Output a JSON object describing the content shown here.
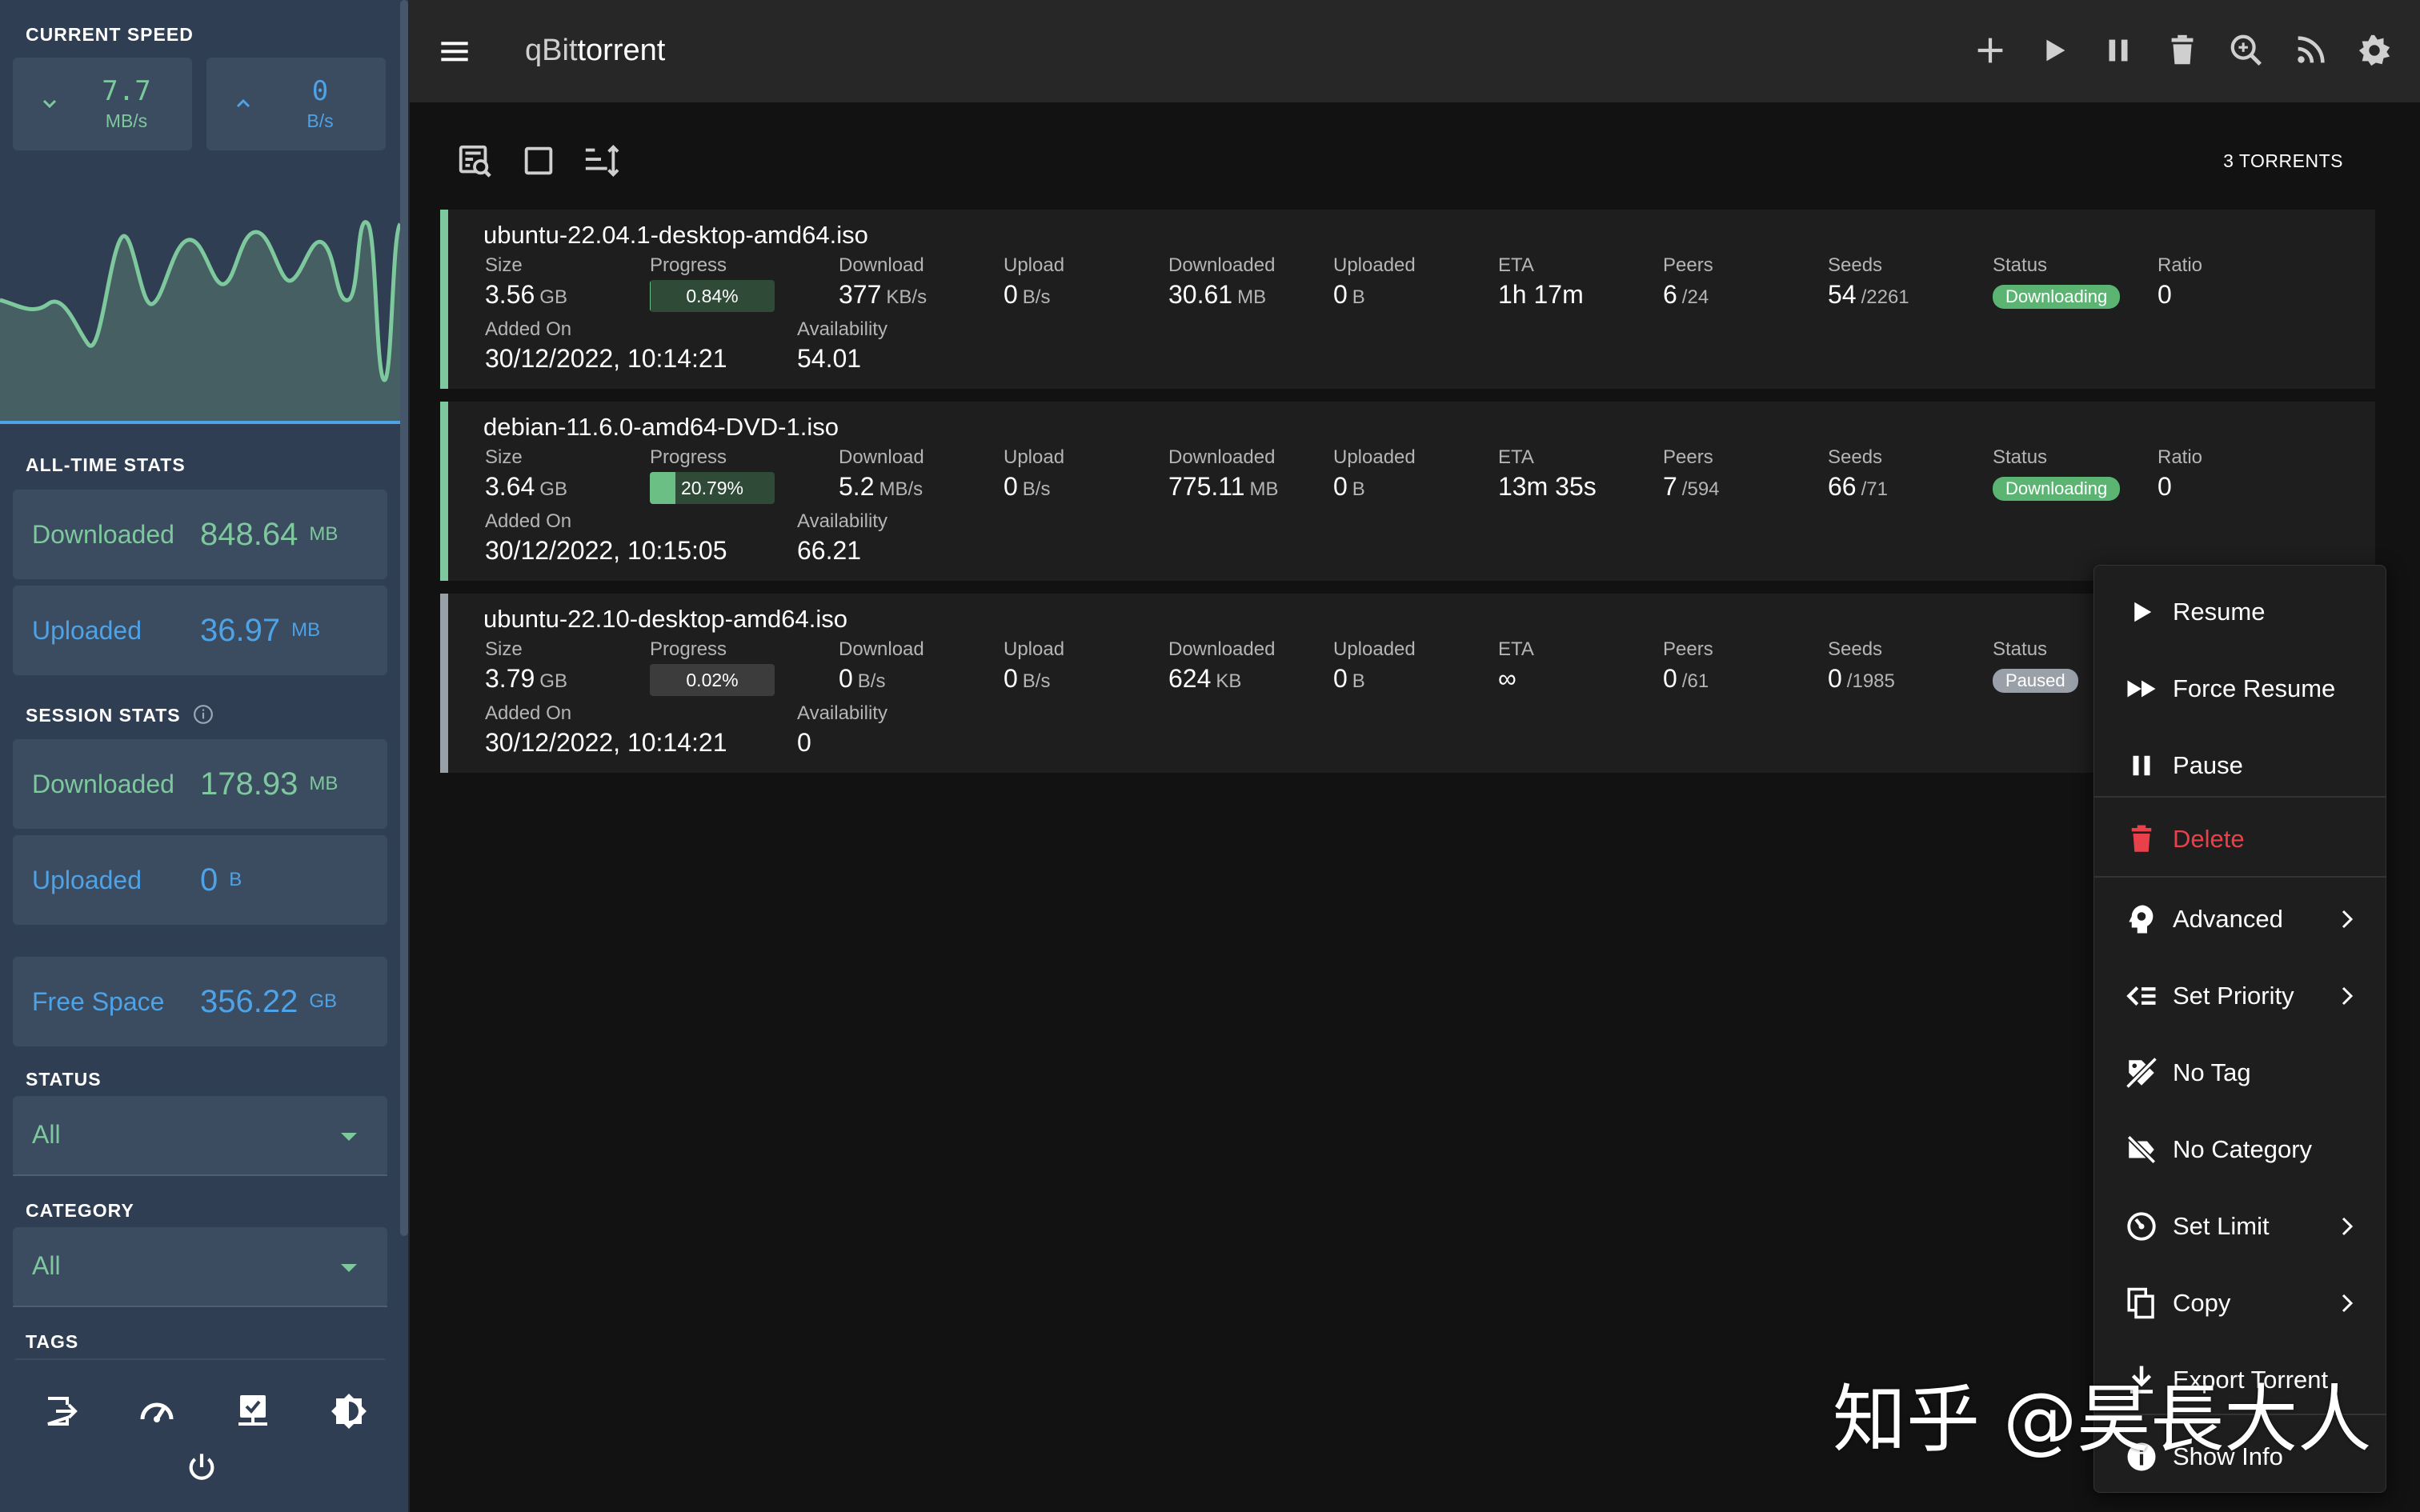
{
  "sidebar": {
    "current_speed_title": "CURRENT SPEED",
    "download_speed": {
      "value": "7.7",
      "unit": "MB/s"
    },
    "upload_speed": {
      "value": "0",
      "unit": "B/s"
    },
    "alltime_title": "ALL-TIME STATS",
    "alltime": {
      "downloaded": {
        "label": "Downloaded",
        "value": "848.64",
        "unit": "MB"
      },
      "uploaded": {
        "label": "Uploaded",
        "value": "36.97",
        "unit": "MB"
      }
    },
    "session_title": "SESSION STATS",
    "session": {
      "downloaded": {
        "label": "Downloaded",
        "value": "178.93",
        "unit": "MB"
      },
      "uploaded": {
        "label": "Uploaded",
        "value": "0",
        "unit": "B"
      }
    },
    "free_space": {
      "label": "Free Space",
      "value": "356.22",
      "unit": "GB"
    },
    "status_title": "STATUS",
    "status_value": "All",
    "category_title": "CATEGORY",
    "category_value": "All",
    "tags_title": "TAGS",
    "footer_icons": [
      "logout-icon",
      "speedometer-icon",
      "server-network-icon",
      "theme-brightness-icon",
      "power-icon"
    ]
  },
  "topbar": {
    "title_prefix": "qBit",
    "title_suffix": "torrent",
    "actions": [
      "add-icon",
      "play-icon",
      "pause-icon",
      "delete-icon",
      "search-plugin-icon",
      "rss-icon",
      "settings-icon"
    ]
  },
  "toolbar": {
    "icons": [
      "filter-search-icon",
      "checkbox-blank-icon",
      "sort-icon"
    ],
    "torrent_count": "3 TORRENTS"
  },
  "columns": {
    "size": "Size",
    "progress": "Progress",
    "download": "Download",
    "upload": "Upload",
    "downloaded": "Downloaded",
    "uploaded": "Uploaded",
    "eta": "ETA",
    "peers": "Peers",
    "seeds": "Seeds",
    "status": "Status",
    "ratio": "Ratio",
    "added_on": "Added On",
    "availability": "Availability"
  },
  "torrents": [
    {
      "name": "ubuntu-22.04.1-desktop-amd64.iso",
      "size": "3.56",
      "size_unit": "GB",
      "progress_text": "0.84%",
      "progress_value": 0.0084,
      "download": "377",
      "download_unit": "KB/s",
      "upload": "0",
      "upload_unit": "B/s",
      "downloaded": "30.61",
      "downloaded_unit": "MB",
      "uploaded": "0",
      "uploaded_unit": "B",
      "eta": "1h 17m",
      "peers": "6",
      "peers_total": "/24",
      "seeds": "54",
      "seeds_total": "/2261",
      "status": "Downloading",
      "ratio": "0",
      "added_on": "30/12/2022, 10:14:21",
      "availability": "54.01"
    },
    {
      "name": "debian-11.6.0-amd64-DVD-1.iso",
      "size": "3.64",
      "size_unit": "GB",
      "progress_text": "20.79%",
      "progress_value": 0.2079,
      "download": "5.2",
      "download_unit": "MB/s",
      "upload": "0",
      "upload_unit": "B/s",
      "downloaded": "775.11",
      "downloaded_unit": "MB",
      "uploaded": "0",
      "uploaded_unit": "B",
      "eta": "13m 35s",
      "peers": "7",
      "peers_total": "/594",
      "seeds": "66",
      "seeds_total": "/71",
      "status": "Downloading",
      "ratio": "0",
      "added_on": "30/12/2022, 10:15:05",
      "availability": "66.21"
    },
    {
      "name": "ubuntu-22.10-desktop-amd64.iso",
      "size": "3.79",
      "size_unit": "GB",
      "progress_text": "0.02%",
      "progress_value": 0.0002,
      "download": "0",
      "download_unit": "B/s",
      "upload": "0",
      "upload_unit": "B/s",
      "downloaded": "624",
      "downloaded_unit": "KB",
      "uploaded": "0",
      "uploaded_unit": "B",
      "eta": "∞",
      "peers": "0",
      "peers_total": "/61",
      "seeds": "0",
      "seeds_total": "/1985",
      "status": "Paused",
      "added_on": "30/12/2022, 10:14:21",
      "availability": "0"
    }
  ],
  "context_menu": [
    {
      "label": "Resume",
      "icon": "play-icon"
    },
    {
      "label": "Force Resume",
      "icon": "fast-forward-icon"
    },
    {
      "label": "Pause",
      "icon": "pause-icon"
    },
    {
      "label": "Delete",
      "icon": "delete-icon"
    },
    {
      "label": "Advanced",
      "icon": "head-cog-icon"
    },
    {
      "label": "Set Priority",
      "icon": "priority-icon"
    },
    {
      "label": "No Tag",
      "icon": "tag-off-icon"
    },
    {
      "label": "No Category",
      "icon": "label-off-icon"
    },
    {
      "label": "Set Limit",
      "icon": "speedometer-icon"
    },
    {
      "label": "Copy",
      "icon": "content-copy-icon"
    },
    {
      "label": "Export Torrent",
      "icon": "download-icon"
    },
    {
      "label": "Show Info",
      "icon": "information-icon"
    }
  ],
  "colors": {
    "accent_green": "#7ec89e",
    "accent_blue": "#4ea2e6",
    "danger": "#e8414b",
    "sidebar_bg": "#2f3e52"
  },
  "watermark": "知乎 @昊長大人"
}
